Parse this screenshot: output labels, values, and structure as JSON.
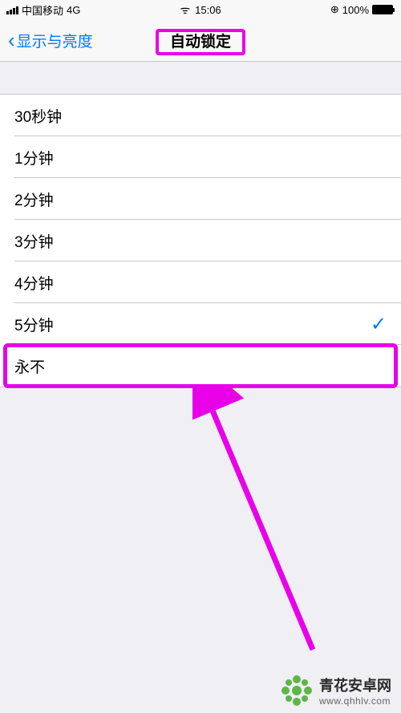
{
  "statusBar": {
    "carrier": "中国移动",
    "network": "4G",
    "time": "15:06",
    "battery": "100%",
    "rotationLock": "⊕"
  },
  "navBar": {
    "backLabel": "显示与亮度",
    "title": "自动锁定"
  },
  "options": [
    {
      "label": "30秒钟",
      "selected": false,
      "highlighted": false
    },
    {
      "label": "1分钟",
      "selected": false,
      "highlighted": false
    },
    {
      "label": "2分钟",
      "selected": false,
      "highlighted": false
    },
    {
      "label": "3分钟",
      "selected": false,
      "highlighted": false
    },
    {
      "label": "4分钟",
      "selected": false,
      "highlighted": false
    },
    {
      "label": "5分钟",
      "selected": true,
      "highlighted": false
    },
    {
      "label": "永不",
      "selected": false,
      "highlighted": true
    }
  ],
  "watermark": {
    "title": "青花安卓网",
    "url": "www.qhhlv.com"
  },
  "annotations": {
    "titleBox": true,
    "arrowColor": "#e800e8"
  }
}
